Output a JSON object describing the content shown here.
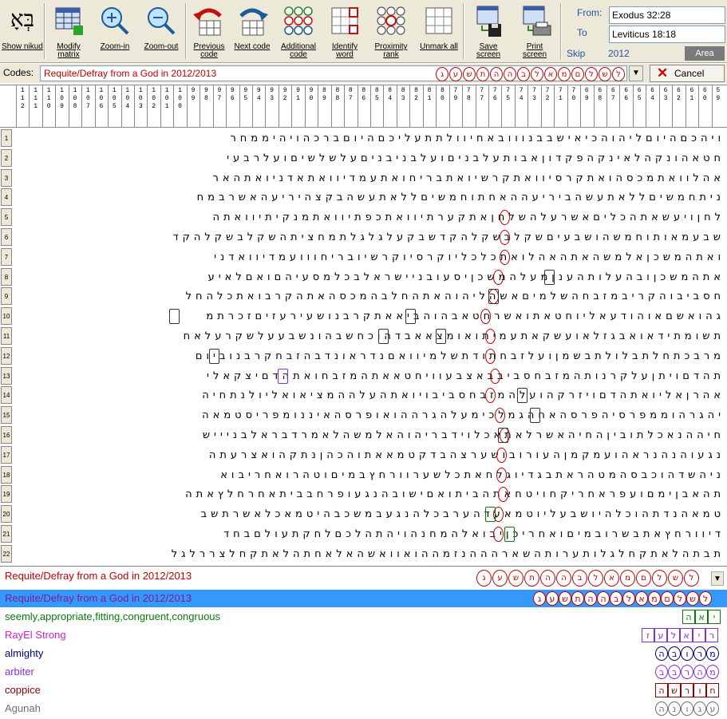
{
  "toolbar": {
    "buttons": [
      {
        "id": "show-nikud",
        "label": "Show nikud",
        "glyph": "בְּאָ"
      },
      {
        "id": "modify-matrix",
        "label": "Modify matrix"
      },
      {
        "id": "zoom-in",
        "label": "Zoom-in"
      },
      {
        "id": "zoom-out",
        "label": "Zoom-out"
      },
      {
        "id": "previous-code",
        "label": "Previous code"
      },
      {
        "id": "next-code",
        "label": "Next code"
      },
      {
        "id": "additional-code",
        "label": "Additional code"
      },
      {
        "id": "identify-word",
        "label": "Identify word"
      },
      {
        "id": "proximity-rank",
        "label": "Proximity rank"
      },
      {
        "id": "unmark-all",
        "label": "Unmark all"
      },
      {
        "id": "save-screen",
        "label": "Save screen"
      },
      {
        "id": "print-screen",
        "label": "Print screen"
      }
    ],
    "from_label": "From:",
    "from_value": "Exodus 32:28",
    "to_label": "To",
    "to_value": "Leviticus 18:18",
    "skip_label": "Skip",
    "skip_value": "2012",
    "area_label": "Area"
  },
  "codes_bar": {
    "label": "Codes:",
    "value": "Requite/Defray from a God in 2012/2013",
    "cancel_label": "Cancel",
    "letters": [
      "ל",
      "ש",
      "ל",
      "ם",
      "מ",
      "א",
      "ל",
      "ב",
      "ה",
      "ה",
      "ת",
      "ש",
      "ע",
      "ג"
    ]
  },
  "column_numbers": [
    "1\n1\n2",
    "1\n1\n1",
    "1\n1\n0",
    "1\n0\n9",
    "1\n0\n8",
    "1\n0\n7",
    "1\n0\n6",
    "1\n0\n5",
    "1\n0\n4",
    "1\n0\n3",
    "1\n0\n2",
    "1\n0\n1",
    "1\n0\n0",
    "9\n9",
    "9\n8",
    "9\n7",
    "9\n6",
    "9\n5",
    "9\n4",
    "9\n3",
    "9\n2",
    "9\n1",
    "9\n0",
    "8\n9",
    "8\n8",
    "8\n7",
    "8\n6",
    "8\n5",
    "8\n4",
    "8\n3",
    "8\n2",
    "8\n1",
    "8\n0",
    "7\n9",
    "7\n8",
    "7\n7",
    "7\n6",
    "7\n5",
    "7\n4",
    "7\n3",
    "7\n2",
    "7\n1",
    "7\n0",
    "6\n9",
    "6\n8",
    "6\n7",
    "6\n6",
    "6\n5",
    "6\n4",
    "6\n3",
    "6\n2",
    "6\n1",
    "6\n0",
    "5\n9"
  ],
  "matrix_rows": [
    "ויהכםהיוםליהוהכיאישבבנווובאחיוולתתעליכםהיוםברכהויהיממחר",
    "חטאהונקהלאינקהפקדוןאבותעלבניםועלבניבניםעלשלשיםועלרבעי",
    "אהלוואתמכסהואתקרסיוואתקרשיואתבריחואתעמדיוואתאדניואתהאר",
    "ניתחמשיםללאתעשהביריעההאחתוחמשיםללאתעשהבקצהיריעהאשרבמח",
    "לחןויעשאתהכליםאשרעלהשלחןאתקערתיוואתכפתיוואתמנקיתיוואתה",
    "שבעמאותוחמשהושבעיםשקלבשקלהקדשבקעלגלגלתמחציתהשקלבשקלהקד",
    "ואתהמשכןאלמשהאתהאהלואתכלכליוקרסיוקרשיובריחווועמדיוואדני",
    "אתהמשכןובהעלותהענןמעלהמשכןיסעובניישראלבכלמסעיהםואםלאיע",
    "חסביבוהקריבמזבחהשלמיםאשהליהוהאתהחלבהמכסהאתהקרבואתכלהחל",
    "גהואשםאוהודעאליוחטאתואשרחטאבהוהביאאתקרבנושעירעזיםזכרתמ",
    "תשומתידאואבגזלאועשקאתעמיתואומצאאבדהוכחשבהונשבעעלשקרעלאח",
    "מרבכתחלתבלולתבשמןועלזבחתודתשלמיוואםנדראונדבהזבחקרבנוביום",
    "תהדםויתןעלקרנותהמזבחסביבבאצבעוויחטאאתהמזבחואתהדםיצקאלי",
    "אהרןאליואתהדםויזרקהועלהמזבחסביבויואתהעלההמציאואליולנתחיה",
    "יהגרהוממפרסיהפרסהאחהגמלכימעלהגרההואופרסהאיננומפריסטמאה",
    "חיההנאכלתוביןהחיהאשרלאתאכלוידבריהוהאלמשהלאמרדבראלבניייש",
    "נגעוהנהנראהועמקמןהעורובושערצהבדקטמאאתוהכהןנתקהואצרעתה",
    "ניהשדהוכבסהמטהראתבגדיוגלחאתכלשערוורחץבמיםוטהרואחריבוא",
    "תהאבןימםועפראחריקחויטחאתהביתואםישובהנגעופרחבביתאחרחלץאתה",
    "טמאהנדתהוכלהיושבעליוטמאעדהערבכלהנגעבמשכבהיטמאכלאשרתשב",
    "דיוורחץאתבשרובמיםואחריכןיבואלהמחנהויהתהלכםלחקתעולםבחד",
    "תבתהלאתקחלגלותערותהשארהההנזמההואוואשהאלאחתהלאתקחלצררלגל"
  ],
  "term_combo": {
    "text": "Requite/Defray from a God in 2012/2013",
    "letters": [
      "ל",
      "ש",
      "ל",
      "ם",
      "מ",
      "א",
      "ל",
      "ב",
      "ה",
      "ה",
      "ת",
      "ש",
      "ע",
      "ג"
    ]
  },
  "terms": [
    {
      "label": "Requite/Defray from a God in 2012/2013",
      "color": "#8a1a8a",
      "letter_color": "#c00000",
      "shape": "oval",
      "selected": true,
      "letters": [
        "ל",
        "ש",
        "ל",
        "ם",
        "מ",
        "א",
        "ל",
        "ב",
        "ה",
        "ה",
        "ת",
        "ש",
        "ע",
        "ג"
      ]
    },
    {
      "label": "seemly,appropriate,fitting,congruent,congruous",
      "color": "#0a7a0a",
      "letter_color": "#0a7a0a",
      "shape": "rect",
      "selected": false,
      "letters": [
        "י",
        "א",
        "ה"
      ]
    },
    {
      "label": "RayEl Strong",
      "color": "#d020d0",
      "letter_color": "#8a2be2",
      "shape": "rect",
      "selected": false,
      "letters": [
        "ר",
        "י",
        "א",
        "ל",
        "ע",
        "ז"
      ]
    },
    {
      "label": "almighty",
      "color": "#000080",
      "letter_color": "#000080",
      "shape": "oval",
      "selected": false,
      "letters": [
        "מ",
        "ר",
        "ו",
        "ב",
        "ה"
      ]
    },
    {
      "label": "arbiter",
      "color": "#8a2be2",
      "letter_color": "#8a2be2",
      "shape": "oval",
      "selected": false,
      "letters": [
        "מ",
        "ה",
        "ר",
        "ב",
        "ב"
      ]
    },
    {
      "label": "coppice",
      "color": "#8b0000",
      "letter_color": "#8b0000",
      "shape": "rect",
      "selected": false,
      "letters": [
        "ח",
        "ו",
        "ר",
        "ש",
        "ה"
      ]
    },
    {
      "label": "Agunah",
      "color": "#707070",
      "letter_color": "#707070",
      "shape": "oval",
      "selected": false,
      "letters": [
        "ע",
        "ג",
        "ו",
        "נ",
        "ה"
      ]
    }
  ],
  "colors": {
    "toolbar_bg": "#ece9d8",
    "selection": "#3399ff",
    "code_red": "#c00000"
  }
}
